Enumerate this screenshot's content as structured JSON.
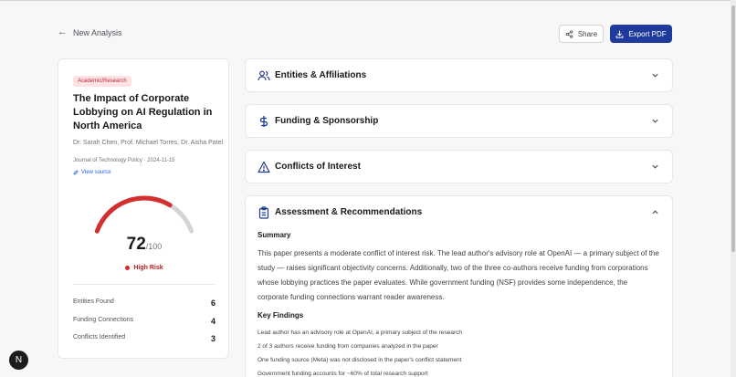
{
  "nav": {
    "back_label": "New Analysis"
  },
  "actions": {
    "share_label": "Share",
    "export_label": "Export PDF"
  },
  "paper": {
    "badge": "Academic/Research",
    "title": "The Impact of Corporate Lobbying on AI Regulation in North America",
    "authors": "Dr. Sarah Chen, Prof. Michael Torres, Dr. Aisha Patel",
    "journal": "Journal of Technology Policy · 2024-11-15",
    "view_source": "View source"
  },
  "risk": {
    "score": "72",
    "max": "/100",
    "score_fraction": 0.72,
    "level": "High Risk",
    "gauge_color": "#d32f2f",
    "track_color": "#d4d4d8"
  },
  "stats": [
    {
      "label": "Entities Found",
      "value": "6"
    },
    {
      "label": "Funding Connections",
      "value": "4"
    },
    {
      "label": "Conflicts Identified",
      "value": "3"
    }
  ],
  "sections": [
    {
      "title": "Entities & Affiliations",
      "icon": "users-icon",
      "expanded": false
    },
    {
      "title": "Funding & Sponsorship",
      "icon": "dollar-icon",
      "expanded": false
    },
    {
      "title": "Conflicts of Interest",
      "icon": "warning-icon",
      "expanded": false
    },
    {
      "title": "Assessment & Recommendations",
      "icon": "clipboard-icon",
      "expanded": true
    }
  ],
  "assessment": {
    "summary_heading": "Summary",
    "summary_text": "This paper presents a moderate conflict of interest risk. The lead author's advisory role at OpenAI — a primary subject of the study — raises significant objectivity concerns. Additionally, two of the three co-authors receive funding from corporations whose lobbying practices the paper evaluates. While government funding (NSF) provides some independence, the corporate funding connections warrant reader awareness.",
    "findings_heading": "Key Findings",
    "findings": [
      "Lead author has an advisory role at OpenAI, a primary subject of the research",
      "2 of 3 authors receive funding from companies analyzed in the paper",
      "One funding source (Meta) was not disclosed in the paper's conflict statement",
      "Government funding accounts for ~60% of total research support"
    ]
  },
  "devtools": {
    "badge_letter": "N"
  }
}
